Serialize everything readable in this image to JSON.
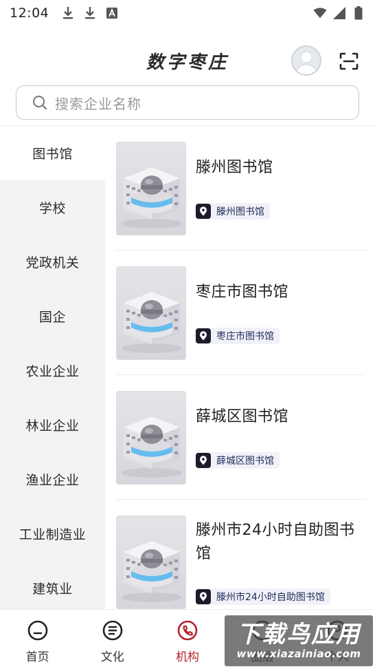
{
  "status_bar": {
    "time": "12:04"
  },
  "header": {
    "title": "数字枣庄"
  },
  "search": {
    "placeholder": "搜索企业名称"
  },
  "sidebar": {
    "items": [
      {
        "label": "图书馆",
        "active": true
      },
      {
        "label": "学校",
        "active": false
      },
      {
        "label": "党政机关",
        "active": false
      },
      {
        "label": "国企",
        "active": false
      },
      {
        "label": "农业企业",
        "active": false
      },
      {
        "label": "林业企业",
        "active": false
      },
      {
        "label": "渔业企业",
        "active": false
      },
      {
        "label": "工业制造业",
        "active": false
      },
      {
        "label": "建筑业",
        "active": false
      }
    ]
  },
  "list": {
    "items": [
      {
        "title": "滕州图书馆",
        "tag": "滕州图书馆"
      },
      {
        "title": "枣庄市图书馆",
        "tag": "枣庄市图书馆"
      },
      {
        "title": "薛城区图书馆",
        "tag": "薛城区图书馆"
      },
      {
        "title": "滕州市24小时自助图书馆",
        "tag": "滕州市24小时自助图书馆"
      }
    ]
  },
  "bottom_nav": {
    "items": [
      {
        "label": "首页",
        "icon": "home-face-icon",
        "active": false
      },
      {
        "label": "文化",
        "icon": "document-list-icon",
        "active": false
      },
      {
        "label": "机构",
        "icon": "phone-circle-icon",
        "active": true
      },
      {
        "label": "圈层",
        "icon": "circle-icon",
        "active": false
      },
      {
        "label": "个人",
        "icon": "user-icon",
        "active": false
      }
    ]
  },
  "watermark": {
    "main": "下载鸟应用",
    "sub": "www.xiazainiao.com"
  },
  "colors": {
    "accent": "#b5232c",
    "sidebar_bg": "#f3f3f3",
    "tag_bg": "#f1f2f8"
  }
}
